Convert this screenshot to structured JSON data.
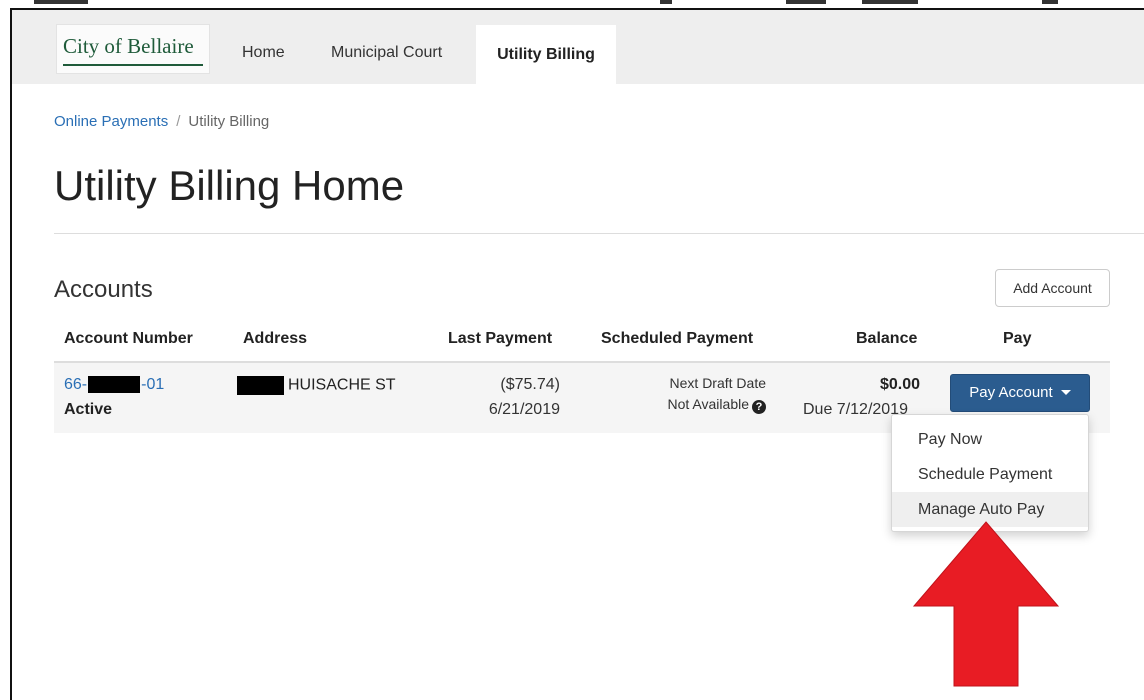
{
  "header": {
    "logo_text": "City of Bellaire",
    "nav": [
      {
        "label": "Home"
      },
      {
        "label": "Municipal Court"
      },
      {
        "label": "Utility Billing"
      }
    ]
  },
  "breadcrumb": {
    "parent": "Online Payments",
    "separator": "/",
    "current": "Utility Billing"
  },
  "page_title": "Utility Billing Home",
  "accounts": {
    "title": "Accounts",
    "add_button": "Add Account",
    "columns": [
      "Account Number",
      "Address",
      "Last Payment",
      "Scheduled Payment",
      "Balance",
      "Pay"
    ],
    "row": {
      "account_prefix": "66-",
      "account_suffix": "-01",
      "status": "Active",
      "address": "HUISACHE ST",
      "last_payment_amount": "($75.74)",
      "last_payment_date": "6/21/2019",
      "scheduled_line1": "Next Draft Date",
      "scheduled_line2": "Not Available",
      "balance": "$0.00",
      "due": "Due 7/12/2019",
      "pay_button": "Pay Account"
    }
  },
  "pay_menu": {
    "items": [
      "Pay Now",
      "Schedule Payment",
      "Manage Auto Pay"
    ],
    "highlighted": "Manage Auto Pay"
  },
  "colors": {
    "link": "#2a6fb5",
    "primary_button": "#2b5c8f",
    "logo_green": "#1f5b3a",
    "annotation_arrow": "#e81c24"
  },
  "icons": {
    "info": "question-circle-icon",
    "dropdown": "caret-down-icon",
    "annotation": "red-up-arrow"
  }
}
